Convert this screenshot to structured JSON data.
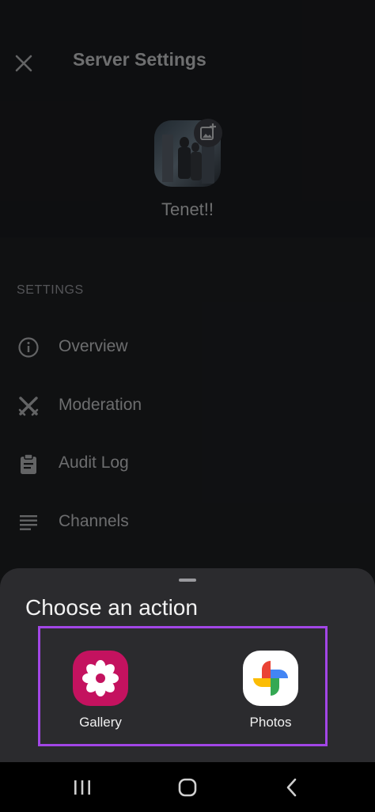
{
  "header": {
    "title": "Server Settings",
    "server_name": "Tenet!!"
  },
  "settings": {
    "section_label": "SETTINGS",
    "items": [
      {
        "label": "Overview",
        "icon": "info-icon"
      },
      {
        "label": "Moderation",
        "icon": "swords-icon"
      },
      {
        "label": "Audit Log",
        "icon": "clipboard-icon"
      },
      {
        "label": "Channels",
        "icon": "list-icon"
      }
    ]
  },
  "action_sheet": {
    "title": "Choose an action",
    "apps": [
      {
        "label": "Gallery",
        "icon": "gallery-flower-icon",
        "color": "#c4125f"
      },
      {
        "label": "Photos",
        "icon": "google-photos-pinwheel-icon",
        "color": "#ffffff"
      }
    ],
    "highlight_color": "#a246e6"
  },
  "navbar": {
    "buttons": [
      "recent-apps",
      "home",
      "back"
    ]
  }
}
